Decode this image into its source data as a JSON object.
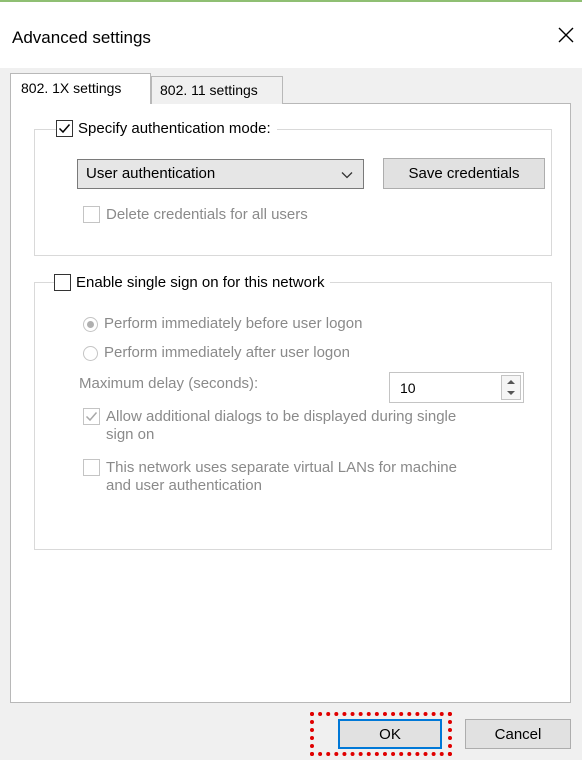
{
  "window": {
    "title": "Advanced settings",
    "close_icon": "close-icon"
  },
  "tabs": [
    {
      "label": "802. 1X settings",
      "active": true
    },
    {
      "label": "802. 11 settings",
      "active": false
    }
  ],
  "auth_group": {
    "specify_label": "Specify authentication mode:",
    "specify_checked": true,
    "mode_value": "User authentication",
    "save_credentials_label": "Save credentials",
    "delete_credentials_label": "Delete credentials for all users",
    "delete_credentials_checked": false
  },
  "sso_group": {
    "enable_label": "Enable single sign on for this network",
    "enable_checked": false,
    "option_before": "Perform immediately before user logon",
    "option_before_selected": true,
    "option_after": "Perform immediately after user logon",
    "option_after_selected": false,
    "max_delay_label": "Maximum delay (seconds):",
    "max_delay_value": "10",
    "allow_dialogs_line1": "Allow additional dialogs to be displayed during single",
    "allow_dialogs_line2": "sign on",
    "allow_dialogs_checked": true,
    "vlan_line1": "This network uses separate virtual LANs for machine",
    "vlan_line2": "and user authentication",
    "vlan_checked": false
  },
  "footer": {
    "ok_label": "OK",
    "cancel_label": "Cancel"
  },
  "colors": {
    "accent_line": "#8fbf73",
    "highlight": "#e00000",
    "focus_border": "#0078d7"
  }
}
